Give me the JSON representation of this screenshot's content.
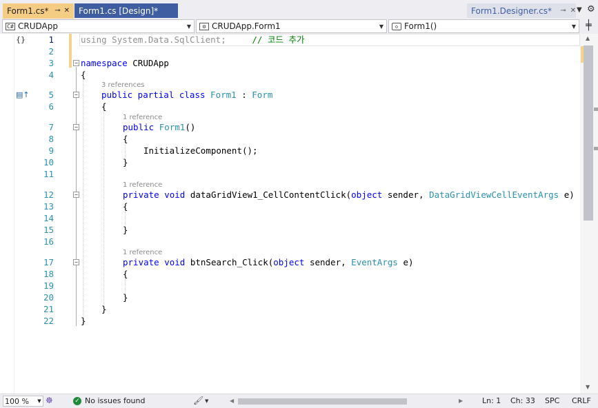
{
  "tabs": [
    {
      "label": "Form1.cs*",
      "pin_icon": "pin-icon",
      "close_icon": "close-icon",
      "active": true
    },
    {
      "label": "Form1.cs [Design]*",
      "active": false
    },
    {
      "label": "Form1.Designer.cs*",
      "pin_icon": "pin-icon",
      "close_icon": "close-icon",
      "active": false
    }
  ],
  "navbar": {
    "project": "CRUDApp",
    "class": "CRUDApp.Form1",
    "member": "Form1()"
  },
  "editor": {
    "line_numbers": [
      "1",
      "2",
      "3",
      "4",
      "5",
      "6",
      "7",
      "8",
      "9",
      "10",
      "11",
      "12",
      "13",
      "14",
      "15",
      "16",
      "17",
      "18",
      "19",
      "20",
      "21",
      "22"
    ],
    "line1": {
      "using": "using",
      "ns": "System.Data.SqlClient;",
      "comment": "// 코드 추가"
    },
    "line3": {
      "kw": "namespace",
      "name": "CRUDApp"
    },
    "line4": "{",
    "refs_class": "3 references",
    "line5": {
      "kw": "public partial class",
      "name": "Form1",
      "sep": " : ",
      "base": "Form"
    },
    "line6": "{",
    "refs_ctor": "1 reference",
    "line7": {
      "kw": "public",
      "name": "Form1",
      "rest": "()"
    },
    "line8": "{",
    "line9": "InitializeComponent();",
    "line10": "}",
    "refs_grid": "1 reference",
    "line12": {
      "kw": "private void",
      "name": "dataGridView1_CellContentClick",
      "p1kw": "object",
      "p1": "sender",
      "p2type": "DataGridViewCellEventArgs",
      "p2": "e)"
    },
    "line13": "{",
    "line15": "}",
    "refs_search": "1 reference",
    "line17": {
      "kw": "private void",
      "name": "btnSearch_Click",
      "p1kw": "object",
      "p1": "sender",
      "p2type": "EventArgs",
      "p2": "e)"
    },
    "line18": "{",
    "line20": "}",
    "line21": "}",
    "line22": "}"
  },
  "statusbar": {
    "zoom": "100 %",
    "issues": "No issues found",
    "line": "Ln: 1",
    "col": "Ch: 33",
    "spacing": "SPC",
    "eol": "CRLF"
  },
  "colors": {
    "keyword": "#0000ff",
    "type": "#2b91af",
    "comment": "#008000",
    "active_tab": "#f5cc84",
    "inactive_tab": "#3f5ea1"
  }
}
